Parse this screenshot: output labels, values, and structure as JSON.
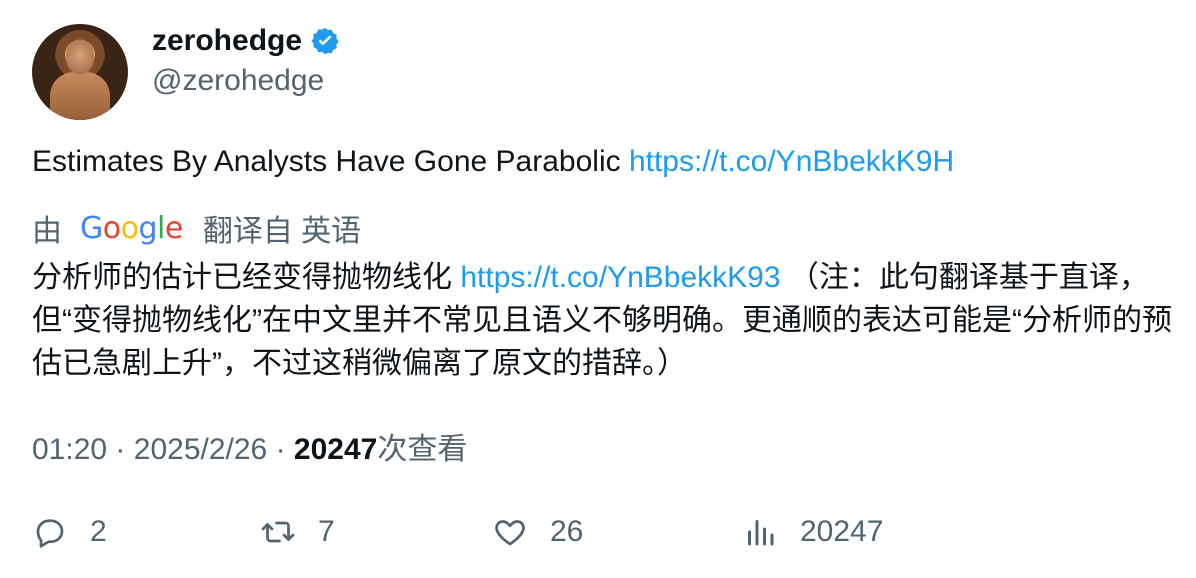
{
  "author": {
    "display_name": "zerohedge",
    "handle": "@zerohedge",
    "verified": true,
    "verified_color": "#1d9bf0"
  },
  "tweet": {
    "text": "Estimates By Analysts Have Gone Parabolic",
    "link": "https://t.co/YnBbekkK9H"
  },
  "translation": {
    "prefix": "由",
    "provider": "Google",
    "suffix": "翻译自 英语",
    "text": "分析师的估计已经变得抛物线化",
    "link": "https://t.co/YnBbekkK93",
    "note": "（注：此句翻译基于直译，但“变得抛物线化”在中文里并不常见且语义不够明确。更通顺的表达可能是“分析师的预估已急剧上升”，不过这稍微偏离了原文的措辞。）"
  },
  "meta": {
    "time": "01:20",
    "separator": "·",
    "date": "2025/2/26",
    "views_count": "20247",
    "views_label": "次查看"
  },
  "actions": {
    "replies": "2",
    "retweets": "7",
    "likes": "26",
    "views": "20247"
  },
  "colors": {
    "link": "#1d9bf0",
    "secondary_text": "#536471",
    "primary_text": "#0f1419"
  }
}
